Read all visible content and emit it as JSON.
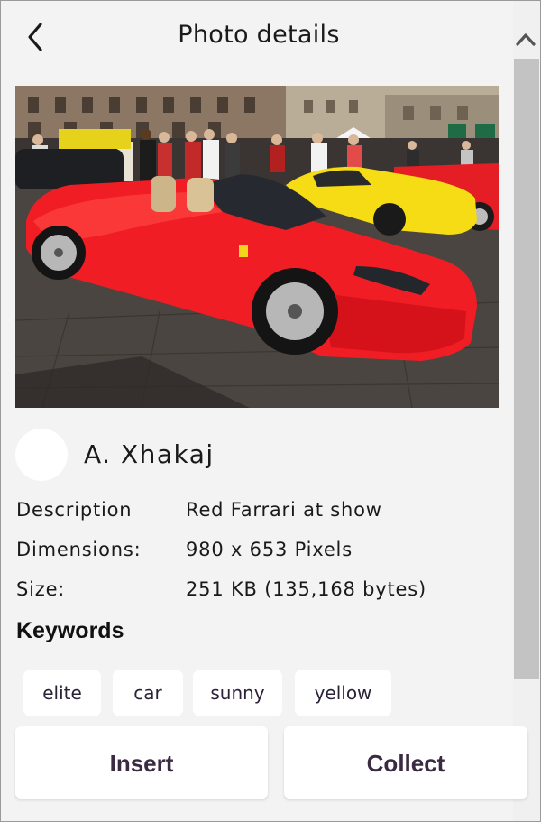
{
  "header": {
    "title": "Photo details",
    "back_icon": "chevron-left-icon"
  },
  "scrollbar": {
    "up_icon": "chevron-up-icon",
    "thumb_color": "#c3c3c3"
  },
  "photo": {
    "subject": "red convertible sports car",
    "colors": {
      "car": "#f01e24",
      "second_car": "#f5dc14",
      "pavement": "#4a4540"
    }
  },
  "author": {
    "name": "A. Xhakaj"
  },
  "details": {
    "description_label": "Description",
    "description_value": "Red Farrari at show",
    "dimensions_label": "Dimensions:",
    "dimensions_value": "980 x 653 Pixels",
    "size_label": "Size:",
    "size_value": "251 KB (135,168 bytes)"
  },
  "keywords": {
    "heading": "Keywords",
    "items": [
      "elite",
      "car",
      "sunny",
      "yellow"
    ]
  },
  "actions": {
    "insert_label": "Insert",
    "collect_label": "Collect",
    "text_color": "#3a2a42"
  }
}
